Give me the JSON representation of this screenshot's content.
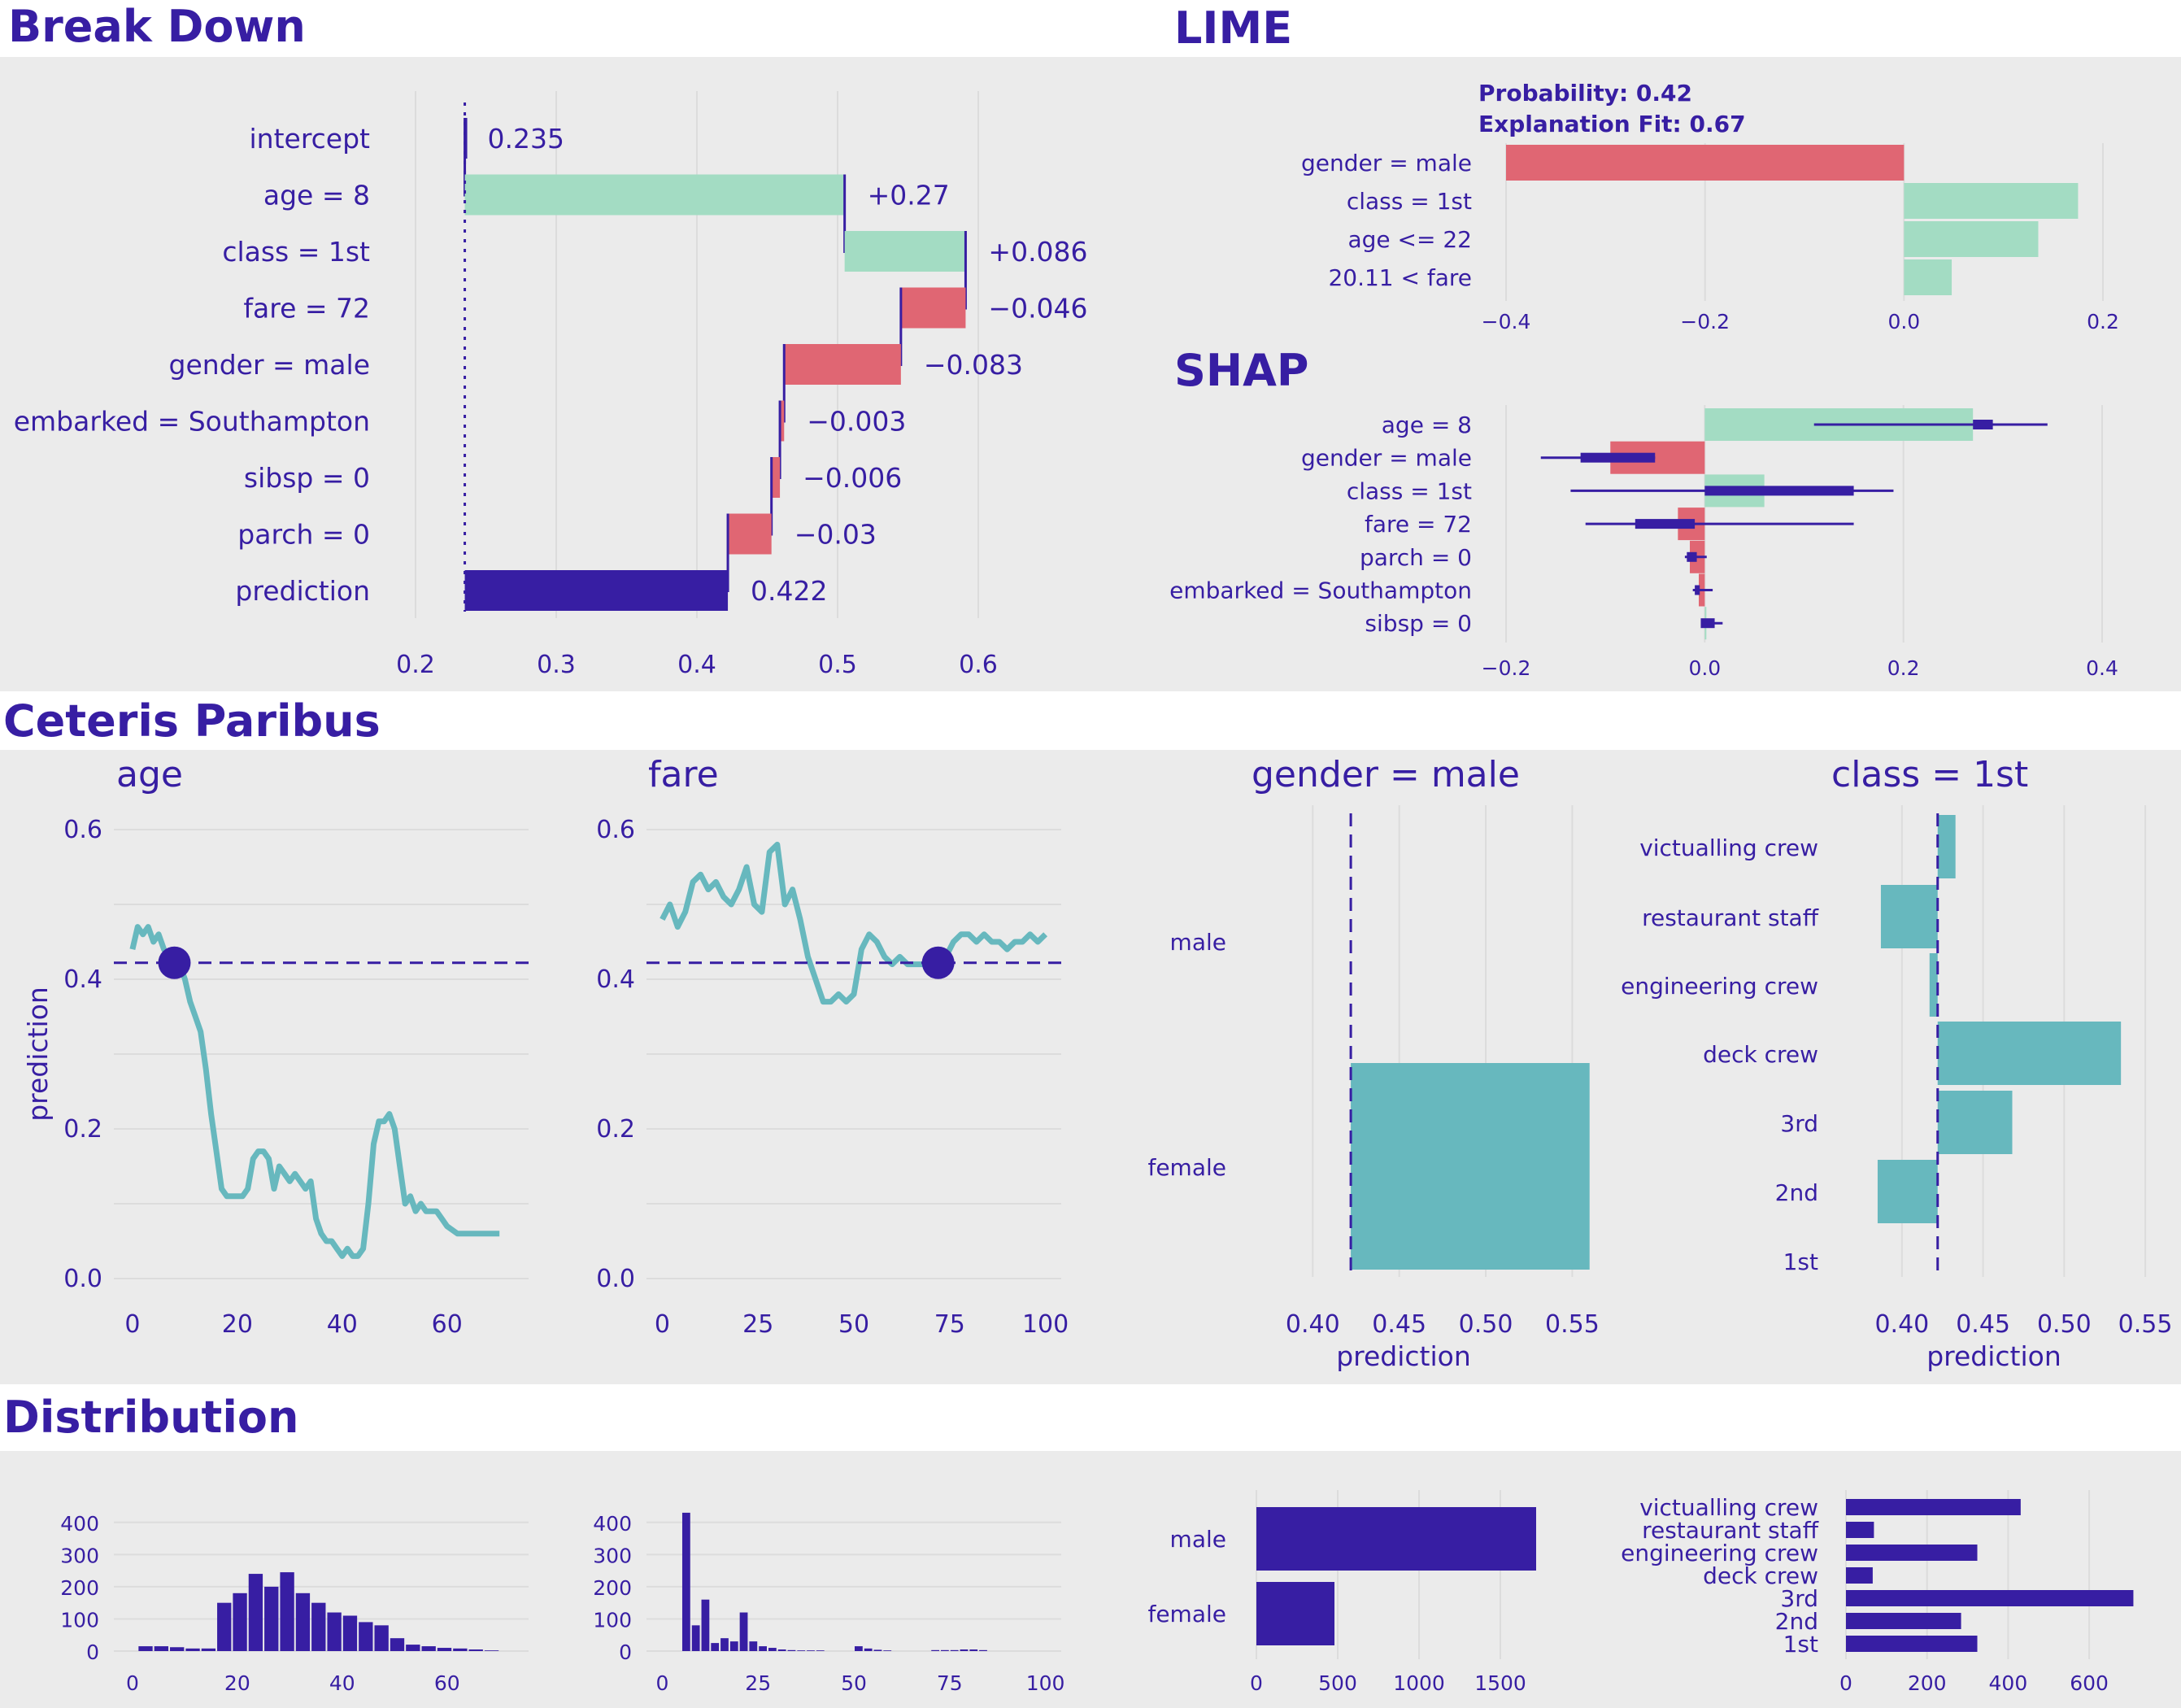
{
  "sections": {
    "break_down": "Break Down",
    "lime": "LIME",
    "shap": "SHAP",
    "ceteris_paribus": "Ceteris Paribus",
    "distribution": "Distribution"
  },
  "colors": {
    "primary": "#371ea3",
    "positive": "#a3dcc3",
    "negative": "#e06673",
    "cp_line": "#67b8be",
    "panel": "#ebebeb"
  },
  "chart_data": [
    {
      "id": "break_down",
      "type": "bar",
      "title": "Break Down",
      "categories": [
        "intercept",
        "age = 8",
        "class = 1st",
        "fare = 72",
        "gender = male",
        "embarked = Southampton",
        "sibsp = 0",
        "parch = 0",
        "prediction"
      ],
      "starts": [
        0.235,
        0.235,
        0.505,
        0.591,
        0.545,
        0.462,
        0.459,
        0.453,
        0.235
      ],
      "ends": [
        0.235,
        0.505,
        0.591,
        0.545,
        0.462,
        0.459,
        0.453,
        0.422,
        0.422
      ],
      "labels": [
        "0.235",
        "+0.27",
        "+0.086",
        "−0.046",
        "−0.083",
        "−0.003",
        "−0.006",
        "−0.03",
        "0.422"
      ],
      "signs": [
        "intercept",
        "pos",
        "pos",
        "neg",
        "neg",
        "neg",
        "neg",
        "neg",
        "pred"
      ],
      "xlim": [
        0.2,
        0.6
      ],
      "xticks": [
        "0.2",
        "0.3",
        "0.4",
        "0.5",
        "0.6"
      ],
      "baseline": 0.235
    },
    {
      "id": "lime",
      "type": "bar",
      "title": "LIME",
      "annotations": [
        "Probability: 0.42",
        "Explanation Fit: 0.67"
      ],
      "categories": [
        "gender = male",
        "class = 1st",
        "age <= 22",
        "20.11 < fare"
      ],
      "values": [
        -0.4,
        0.175,
        0.135,
        0.048
      ],
      "xlim": [
        -0.4,
        0.2
      ],
      "xticks": [
        "−0.4",
        "−0.2",
        "0.0",
        "0.2"
      ]
    },
    {
      "id": "shap",
      "type": "bar",
      "title": "SHAP",
      "categories": [
        "age = 8",
        "gender = male",
        "class = 1st",
        "fare = 72",
        "parch = 0",
        "embarked = Southampton",
        "sibsp = 0"
      ],
      "values": [
        0.27,
        -0.095,
        0.06,
        -0.027,
        -0.015,
        -0.006,
        0.001
      ],
      "whisker_low": [
        0.11,
        -0.165,
        -0.135,
        -0.12,
        -0.02,
        -0.012,
        -0.003
      ],
      "whisker_high": [
        0.345,
        -0.05,
        0.19,
        0.15,
        0.002,
        0.008,
        0.018
      ],
      "box_low": [
        0.27,
        -0.125,
        0.0,
        -0.07,
        -0.018,
        -0.01,
        -0.004
      ],
      "box_high": [
        0.29,
        -0.05,
        0.15,
        -0.01,
        -0.008,
        -0.005,
        0.01
      ],
      "xlim": [
        -0.2,
        0.4
      ],
      "xticks": [
        "−0.2",
        "0.0",
        "0.2",
        "0.4"
      ]
    },
    {
      "id": "cp_age",
      "type": "line",
      "title": "age",
      "ylabel": "prediction",
      "x": [
        0,
        1,
        2,
        3,
        4,
        5,
        6,
        7,
        8,
        9,
        10,
        11,
        12,
        13,
        14,
        15,
        16,
        17,
        18,
        19,
        20,
        21,
        22,
        23,
        24,
        25,
        26,
        27,
        28,
        29,
        30,
        31,
        32,
        33,
        34,
        35,
        36,
        37,
        38,
        39,
        40,
        41,
        42,
        43,
        44,
        45,
        46,
        47,
        48,
        49,
        50,
        51,
        52,
        53,
        54,
        55,
        56,
        57,
        58,
        59,
        60,
        62,
        65,
        70
      ],
      "y": [
        0.44,
        0.47,
        0.46,
        0.47,
        0.45,
        0.46,
        0.44,
        0.43,
        0.42,
        0.42,
        0.4,
        0.37,
        0.35,
        0.33,
        0.28,
        0.22,
        0.17,
        0.12,
        0.11,
        0.11,
        0.11,
        0.11,
        0.12,
        0.16,
        0.17,
        0.17,
        0.16,
        0.12,
        0.15,
        0.14,
        0.13,
        0.14,
        0.13,
        0.12,
        0.13,
        0.08,
        0.06,
        0.05,
        0.05,
        0.04,
        0.03,
        0.04,
        0.03,
        0.03,
        0.04,
        0.1,
        0.18,
        0.21,
        0.21,
        0.22,
        0.2,
        0.15,
        0.1,
        0.11,
        0.09,
        0.1,
        0.09,
        0.09,
        0.09,
        0.08,
        0.07,
        0.06,
        0.06,
        0.06
      ],
      "observation": {
        "x": 8,
        "y": 0.422
      },
      "ylim": [
        0,
        0.6
      ],
      "xlim": [
        -2,
        74
      ],
      "xticks": [
        "0",
        "20",
        "40",
        "60"
      ],
      "yticks": [
        "0.0",
        "0.2",
        "0.4",
        "0.6"
      ],
      "hline": 0.422
    },
    {
      "id": "cp_fare",
      "type": "line",
      "title": "fare",
      "x": [
        0,
        2,
        4,
        6,
        8,
        10,
        12,
        14,
        16,
        18,
        20,
        22,
        24,
        26,
        28,
        30,
        32,
        34,
        36,
        38,
        40,
        42,
        44,
        46,
        48,
        50,
        52,
        54,
        56,
        58,
        60,
        62,
        64,
        66,
        68,
        70,
        72,
        74,
        76,
        78,
        80,
        82,
        84,
        86,
        88,
        90,
        92,
        94,
        96,
        98,
        100
      ],
      "y": [
        0.48,
        0.5,
        0.47,
        0.49,
        0.53,
        0.54,
        0.52,
        0.53,
        0.51,
        0.5,
        0.52,
        0.55,
        0.5,
        0.49,
        0.57,
        0.58,
        0.5,
        0.52,
        0.48,
        0.43,
        0.4,
        0.37,
        0.37,
        0.38,
        0.37,
        0.38,
        0.44,
        0.46,
        0.45,
        0.43,
        0.42,
        0.43,
        0.42,
        0.42,
        0.42,
        0.42,
        0.42,
        0.43,
        0.45,
        0.46,
        0.46,
        0.45,
        0.46,
        0.45,
        0.45,
        0.44,
        0.45,
        0.45,
        0.46,
        0.45,
        0.46
      ],
      "observation": {
        "x": 72,
        "y": 0.422
      },
      "ylim": [
        0,
        0.6
      ],
      "xlim": [
        -2,
        102
      ],
      "xticks": [
        "0",
        "25",
        "50",
        "75",
        "100"
      ],
      "yticks": [
        "0.0",
        "0.2",
        "0.4",
        "0.6"
      ],
      "hline": 0.422
    },
    {
      "id": "cp_gender",
      "type": "bar",
      "title": "gender = male",
      "xlabel": "prediction",
      "categories": [
        "male",
        "female"
      ],
      "values": [
        0.422,
        0.56
      ],
      "baseline": 0.422,
      "xlim": [
        0.39,
        0.57
      ],
      "xticks": [
        "0.40",
        "0.45",
        "0.50",
        "0.55"
      ]
    },
    {
      "id": "cp_class",
      "type": "bar",
      "title": "class = 1st",
      "xlabel": "prediction",
      "categories": [
        "victualling crew",
        "restaurant staff",
        "engineering crew",
        "deck crew",
        "3rd",
        "2nd",
        "1st"
      ],
      "values": [
        0.433,
        0.387,
        0.417,
        0.535,
        0.468,
        0.385,
        0.422
      ],
      "baseline": 0.422,
      "xlim": [
        0.375,
        0.565
      ],
      "xticks": [
        "0.40",
        "0.45",
        "0.50",
        "0.55"
      ]
    },
    {
      "id": "dist_age",
      "type": "bar",
      "bin_start": [
        1,
        4,
        7,
        10,
        13,
        16,
        19,
        22,
        25,
        28,
        31,
        34,
        37,
        40,
        43,
        46,
        49,
        52,
        55,
        58,
        61,
        64,
        67
      ],
      "values": [
        15,
        15,
        12,
        8,
        8,
        150,
        180,
        240,
        200,
        245,
        180,
        150,
        120,
        110,
        90,
        80,
        40,
        20,
        15,
        10,
        8,
        5,
        2
      ],
      "bin_width": 3,
      "ylim": [
        0,
        450
      ],
      "xlim": [
        -2,
        74
      ],
      "xticks": [
        "0",
        "20",
        "40",
        "60"
      ],
      "yticks": [
        "0",
        "100",
        "200",
        "300",
        "400"
      ]
    },
    {
      "id": "dist_fare",
      "type": "bar",
      "bin_start": [
        5,
        7.5,
        10,
        12.5,
        15,
        17.5,
        20,
        22.5,
        25,
        27.5,
        30,
        32.5,
        35,
        37.5,
        40,
        50,
        52.5,
        55,
        57.5,
        70,
        72.5,
        75,
        77.5,
        80,
        82.5
      ],
      "values": [
        430,
        80,
        160,
        25,
        40,
        30,
        120,
        30,
        15,
        10,
        5,
        3,
        2,
        2,
        2,
        15,
        8,
        4,
        2,
        3,
        3,
        3,
        5,
        5,
        3
      ],
      "bin_width": 2.5,
      "ylim": [
        0,
        450
      ],
      "xlim": [
        -2,
        102
      ],
      "xticks": [
        "0",
        "25",
        "50",
        "75",
        "100"
      ],
      "yticks": [
        "0",
        "100",
        "200",
        "300",
        "400"
      ]
    },
    {
      "id": "dist_gender",
      "type": "bar",
      "categories": [
        "male",
        "female"
      ],
      "values": [
        1720,
        480
      ],
      "xlim": [
        0,
        1800
      ],
      "xticks": [
        "0",
        "500",
        "1000",
        "1500"
      ]
    },
    {
      "id": "dist_class",
      "type": "bar",
      "categories": [
        "victualling crew",
        "restaurant staff",
        "engineering crew",
        "deck crew",
        "3rd",
        "2nd",
        "1st"
      ],
      "values": [
        431,
        69,
        324,
        66,
        709,
        284,
        324
      ],
      "xlim": [
        0,
        730
      ],
      "xticks": [
        "0",
        "200",
        "400",
        "600"
      ]
    }
  ]
}
